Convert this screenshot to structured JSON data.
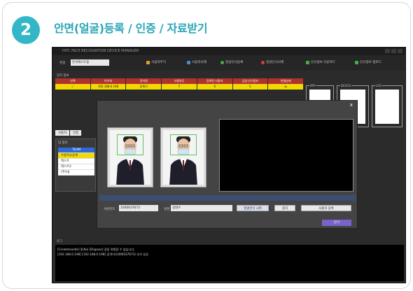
{
  "header": {
    "step_number": "2",
    "title": "안면(얼굴)등록 / 인증 / 자료받기"
  },
  "app": {
    "window_title": "HITC FACE RECOGNITION DEVICE MANAGER",
    "toolbar": {
      "site_label": "현장",
      "site_value": "본사테스트용",
      "buttons": [
        {
          "label": "사용자추가",
          "icon": "user-add-icon",
          "color": "#e0a030"
        },
        {
          "label": "사용자삭제",
          "icon": "user-delete-icon",
          "color": "#4a8ad8"
        },
        {
          "label": "얼굴인식등록",
          "icon": "face-register-icon",
          "color": "#40b040"
        },
        {
          "label": "얼굴인식삭제",
          "icon": "face-delete-icon",
          "color": "#d04040"
        },
        {
          "label": "인식정보 다운로드",
          "icon": "download-icon",
          "color": "#40b040"
        },
        {
          "label": "인식정보 업로드",
          "icon": "upload-icon",
          "color": "#40b040"
        }
      ]
    },
    "device_section_label": "장치 정보",
    "grid": {
      "headers": [
        "선택",
        "아이피",
        "장치명",
        "사용유무",
        "등록된 사용자",
        "금일 인식정보",
        "연결상태"
      ],
      "row": [
        "✓",
        "192.168.0.198",
        "등록기",
        "Y",
        "0",
        "5",
        "⇆"
      ]
    },
    "panels": {
      "panel1": "IMP",
      "panel2": "DEVICE",
      "panel3": "LOG"
    },
    "tabs": [
      "사용자",
      "인증"
    ],
    "group_panel": {
      "caption": "팀 정보",
      "items": [
        "TEAM",
        "수원지소등록",
        "테스트",
        "테스트2",
        "(주)HJ"
      ]
    },
    "log": {
      "caption": "로그",
      "lines": [
        "[Createhandle] 중계서 [Dispose] 감동 위원장 수 없습니다.",
        "[192.168.0.198] [192.168.0.198] 감격이(1000037673) 추가 성공"
      ]
    },
    "dialog": {
      "close": "x",
      "id_label": "사원번호",
      "id_value": "1000037673",
      "name_label": "성명",
      "name_value": "김대수",
      "buttons": [
        "얼굴인식 시작",
        "중지",
        "사용자 등록"
      ],
      "ok": "닫기"
    }
  },
  "colors": {
    "accent": "#33b7c7",
    "grid_header": "#b0322f",
    "grid_row": "#f2d900",
    "team_highlight": "#2f6bd5",
    "ok_button": "#7a63c8"
  }
}
